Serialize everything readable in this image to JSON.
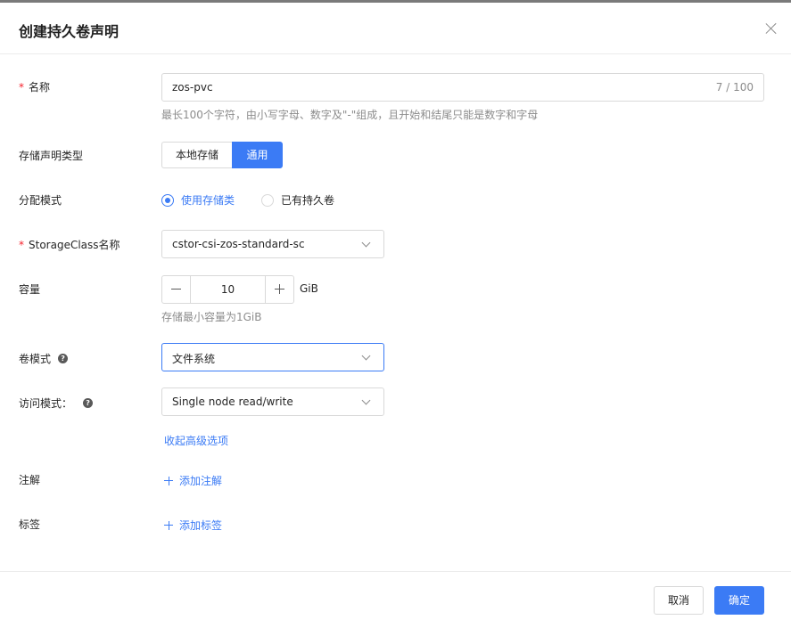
{
  "dialog": {
    "title": "创建持久卷声明",
    "close_icon": "close-icon"
  },
  "form": {
    "name": {
      "required": "*",
      "label": "名称",
      "value": "zos-pvc",
      "counter": "7 / 100",
      "hint": "最长100个字符，由小写字母、数字及\"-\"组成，且开始和结尾只能是数字和字母"
    },
    "claim_type": {
      "label": "存储声明类型",
      "options": [
        "本地存储",
        "通用"
      ],
      "selected": "通用"
    },
    "alloc_mode": {
      "label": "分配模式",
      "options": [
        "使用存储类",
        "已有持久卷"
      ],
      "selected": "使用存储类"
    },
    "storage_class": {
      "required": "*",
      "label": "StorageClass名称",
      "value": "cstor-csi-zos-standard-sc"
    },
    "capacity": {
      "label": "容量",
      "value": "10",
      "unit": "GiB",
      "hint": "存储最小容量为1GiB"
    },
    "volume_mode": {
      "label": "卷模式",
      "help": "?",
      "value": "文件系统"
    },
    "access_mode": {
      "label": "访问模式：",
      "help": "?",
      "value": "Single node read/write"
    },
    "advanced_toggle": "收起高级选项",
    "annotations": {
      "label": "注解",
      "add_label": "添加注解"
    },
    "labels": {
      "label": "标签",
      "add_label": "添加标签"
    }
  },
  "footer": {
    "cancel_label": "取消",
    "ok_label": "确定"
  },
  "colors": {
    "accent": "#3b7bf5",
    "required": "#f5222d"
  }
}
